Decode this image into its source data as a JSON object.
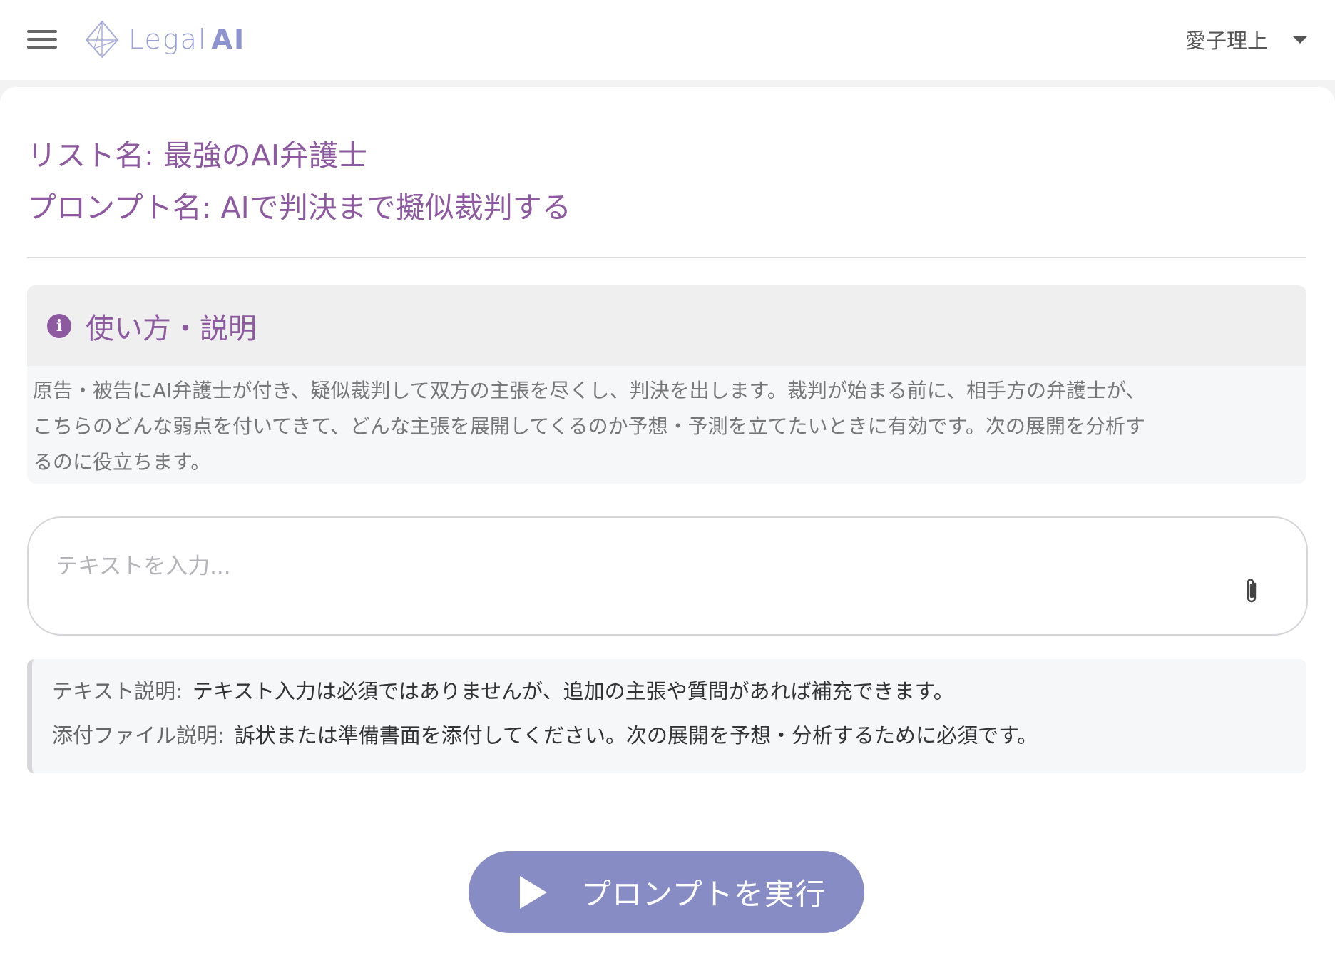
{
  "header": {
    "logo_text_legal": "Legal",
    "logo_text_ai": "AI",
    "user_name": "愛子理上"
  },
  "page": {
    "list_title": "リスト名: 最強のAI弁護士",
    "prompt_title": "プロンプト名: AIで判決まで擬似裁判する"
  },
  "howto": {
    "heading": "使い方・説明",
    "icon": "info-icon",
    "lines": [
      "原告・被告にAI弁護士が付き、疑似裁判して双方の主張を尽くし、判決を出します。裁判が始まる前に、相手方の弁護士が、",
      "こちらのどんな弱点を付いてきて、どんな主張を展開してくるのか予想・予測を立てたいときに有効です。次の展開を分析す",
      "るのに役立ちます。"
    ]
  },
  "input": {
    "placeholder": "テキストを入力...",
    "value": ""
  },
  "descriptions": {
    "text_label": "テキスト説明:",
    "text_value": "テキスト入力は必須ではありませんが、追加の主張や質問があれば補充できます。",
    "file_label": "添付ファイル説明:",
    "file_value": "訴状または準備書面を添付してください。次の展開を予想・分析するために必須です。"
  },
  "run_button": {
    "label": "プロンプトを実行"
  },
  "colors": {
    "accent_purple": "#8d5aa0",
    "button_blue": "#888cc4",
    "logo_blue": "#9aa0d4"
  }
}
